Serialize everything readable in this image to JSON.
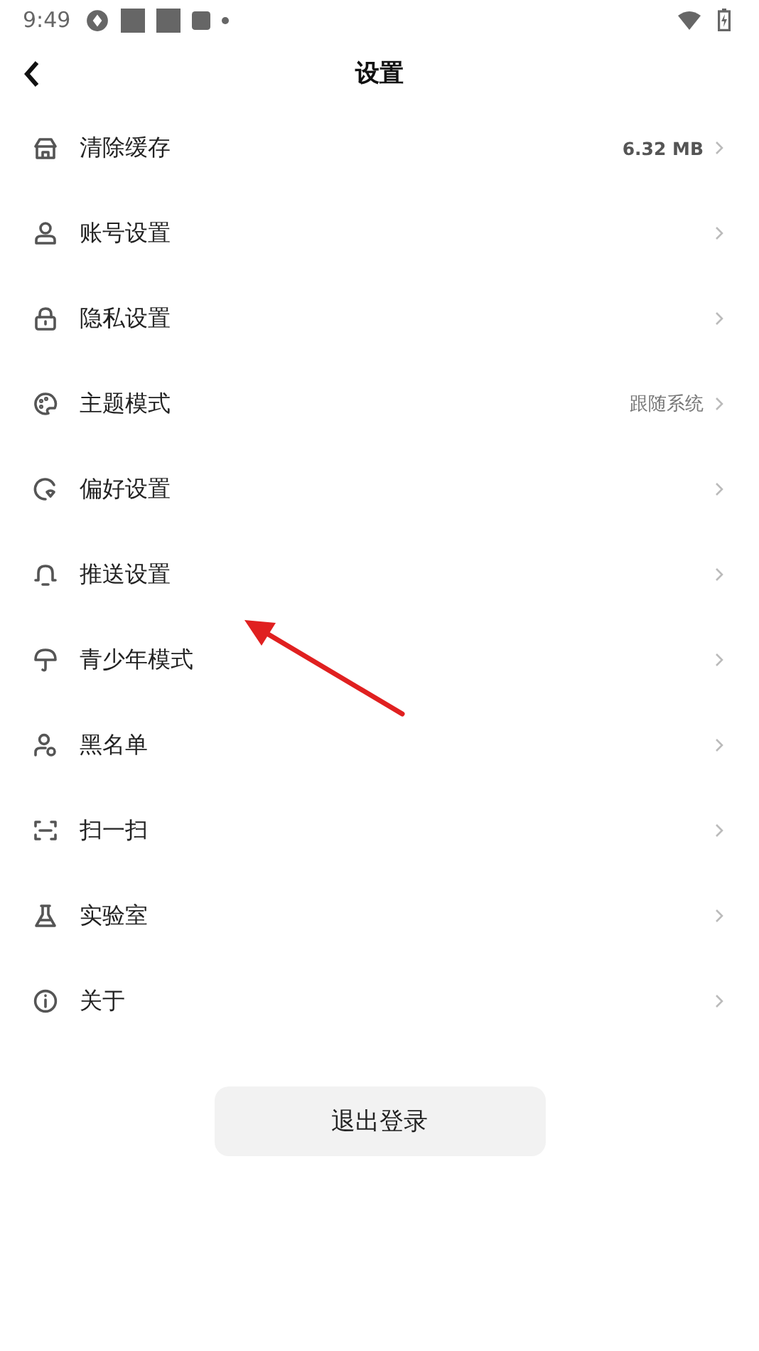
{
  "status_bar": {
    "time": "9:49"
  },
  "header": {
    "title": "设置"
  },
  "items": [
    {
      "label": "清除缓存",
      "value": "6.32 MB",
      "kind": "bold"
    },
    {
      "label": "账号设置"
    },
    {
      "label": "隐私设置"
    },
    {
      "label": "主题模式",
      "value": "跟随系统",
      "kind": "plain"
    },
    {
      "label": "偏好设置"
    },
    {
      "label": "推送设置"
    },
    {
      "label": "青少年模式"
    },
    {
      "label": "黑名单"
    },
    {
      "label": "扫一扫"
    },
    {
      "label": "实验室"
    },
    {
      "label": "关于"
    }
  ],
  "logout_button": {
    "label": "退出登录"
  }
}
